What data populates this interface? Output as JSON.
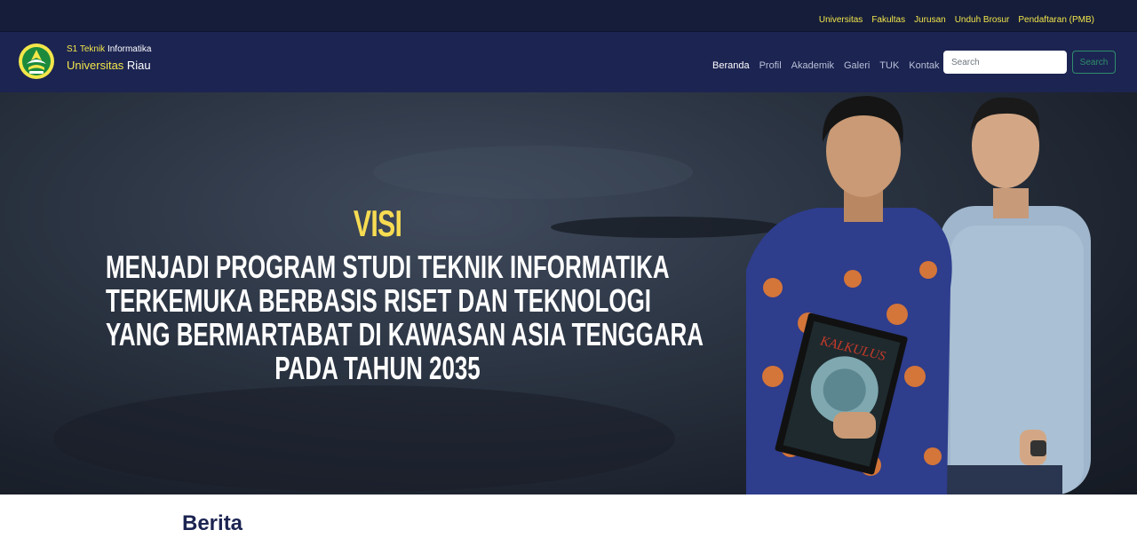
{
  "topbar": {
    "links": [
      "Universitas",
      "Fakultas",
      "Jurusan",
      "Unduh Brosur",
      "Pendaftaran (PMB)"
    ]
  },
  "brand": {
    "line1_yellow": "S1 Teknik",
    "line1_white": " Informatika",
    "line2_yellow": "Universitas",
    "line2_white": " Riau"
  },
  "nav": {
    "items": [
      "Beranda",
      "Profil",
      "Akademik",
      "Galeri",
      "TUK",
      "Kontak"
    ],
    "active": "Beranda"
  },
  "search": {
    "placeholder": "Search",
    "button_label": "Search"
  },
  "hero": {
    "title": "VISI",
    "lines": [
      "MENJADI PROGRAM STUDI TEKNIK INFORMATIKA",
      "TERKEMUKA BERBASIS RISET DAN TEKNOLOGI",
      "YANG BERMARTABAT DI KAWASAN ASIA TENGGARA",
      "PADA TAHUN 2035"
    ],
    "book_title": "KALKULUS"
  },
  "section": {
    "title": "Berita"
  },
  "colors": {
    "topbar_bg": "#161d3a",
    "navbar_bg": "#1c2452",
    "accent_yellow": "#f2e64a",
    "visi_yellow": "#f7dc52",
    "search_green": "#2f8f6b"
  },
  "icons": {
    "logo": "universitas-riau-logo-icon"
  }
}
